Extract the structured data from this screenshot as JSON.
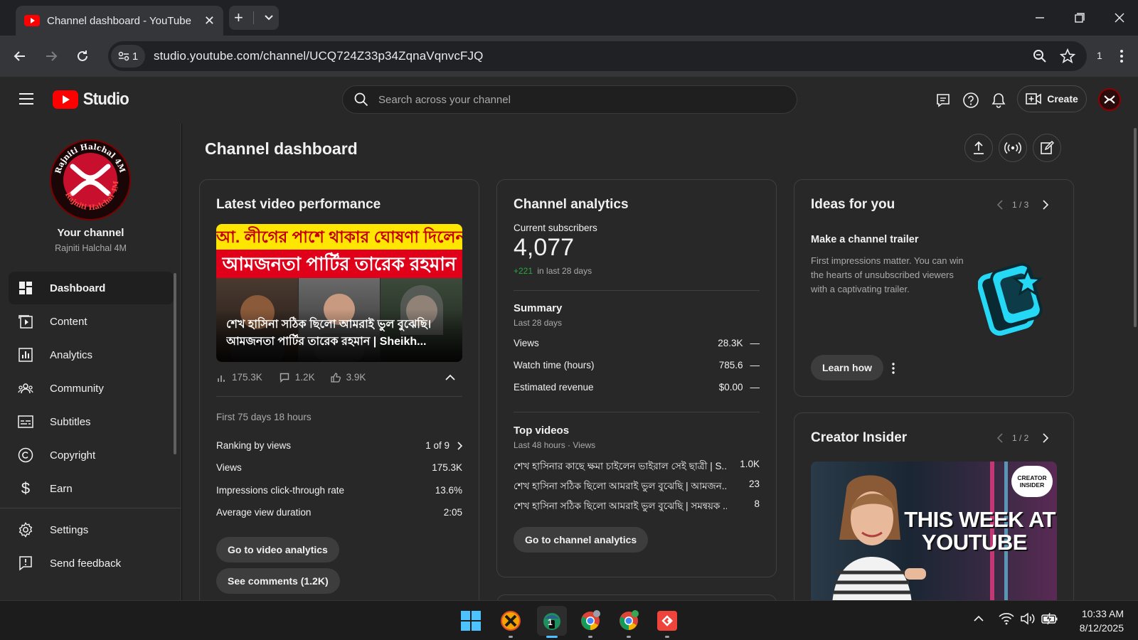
{
  "browser": {
    "tab_title": "Channel dashboard - YouTube Studio",
    "url": "studio.youtube.com/channel/UCQ724Z33p34ZqnaVqnvcFJQ",
    "site_info_count": "1",
    "extensions_count": "1"
  },
  "header": {
    "logo_text": "Studio",
    "search_placeholder": "Search across your channel",
    "create_label": "Create"
  },
  "sidebar": {
    "channel_label": "Your channel",
    "channel_name": "Rajniti Halchal 4M",
    "avatar_text_top": "Rajniti Halchal 4M",
    "avatar_text_bottom": "Rajniti Halchal 4M",
    "items": [
      {
        "label": "Dashboard",
        "icon": "dashboard-icon"
      },
      {
        "label": "Content",
        "icon": "content-icon"
      },
      {
        "label": "Analytics",
        "icon": "analytics-icon"
      },
      {
        "label": "Community",
        "icon": "community-icon"
      },
      {
        "label": "Subtitles",
        "icon": "subtitles-icon"
      },
      {
        "label": "Copyright",
        "icon": "copyright-icon"
      },
      {
        "label": "Earn",
        "icon": "earn-icon"
      }
    ],
    "bottom_items": [
      {
        "label": "Settings",
        "icon": "settings-icon"
      },
      {
        "label": "Send feedback",
        "icon": "feedback-icon"
      }
    ]
  },
  "main": {
    "page_title": "Channel dashboard",
    "latest_video": {
      "title": "Latest video performance",
      "thumb_line1": "আ. লীগের পাশে থাকার ঘোষণা দিলেন",
      "thumb_line2": "আমজনতা পার্টির তারেক রহমান",
      "video_title": "শেখ হাসিনা সঠিক ছিলো আমরাই ভুল বুঝেছি। আমজনতা পার্টির তারেক রহমান | Sheikh...",
      "views_stat": "175.3K",
      "comments_stat": "1.2K",
      "likes_stat": "3.9K",
      "period": "First 75 days 18 hours",
      "rows": [
        {
          "label": "Ranking by views",
          "value": "1 of 9"
        },
        {
          "label": "Views",
          "value": "175.3K"
        },
        {
          "label": "Impressions click-through rate",
          "value": "13.6%"
        },
        {
          "label": "Average view duration",
          "value": "2:05"
        }
      ],
      "btn_analytics": "Go to video analytics",
      "btn_comments": "See comments (1.2K)"
    },
    "channel_analytics": {
      "title": "Channel analytics",
      "subs_label": "Current subscribers",
      "subs_value": "4,077",
      "subs_change": "+221",
      "subs_change_period": "in last 28 days",
      "summary_title": "Summary",
      "summary_period": "Last 28 days",
      "summary_rows": [
        {
          "label": "Views",
          "value": "28.3K",
          "trend": "—"
        },
        {
          "label": "Watch time (hours)",
          "value": "785.6",
          "trend": "—"
        },
        {
          "label": "Estimated revenue",
          "value": "$0.00",
          "trend": "—"
        }
      ],
      "top_title": "Top videos",
      "top_period": "Last 48 hours · Views",
      "top_videos": [
        {
          "title": "শেখ হাসিনার কাছে ক্ষমা চাইলেন ভাইরাল সেই ছাত্রী | S...",
          "views": "1.0K"
        },
        {
          "title": "শেখ হাসিনা সঠিক ছিলো আমরাই ভুল বুঝেছি | আমজন...",
          "views": "23"
        },
        {
          "title": "শেখ হাসিনা সঠিক ছিলো আমরাই ভুল বুঝেছি | সমন্বয়ক ...",
          "views": "8"
        }
      ],
      "btn_channel": "Go to channel analytics"
    },
    "ideas": {
      "title": "Ideas for you",
      "pager": "1 / 3",
      "idea_title": "Make a channel trailer",
      "idea_text": "First impressions matter. You can win the hearts of unsubscribed viewers with a captivating trailer.",
      "btn_learn": "Learn how"
    },
    "creator_insider": {
      "title": "Creator Insider",
      "pager": "1 / 2",
      "thumb_headline_1": "THIS WEEK AT",
      "thumb_headline_2": "YOUTUBE",
      "badge_line1": "CREATOR",
      "badge_line2": "INSIDER"
    }
  },
  "taskbar": {
    "time": "10:33 AM",
    "date": "8/12/2025",
    "badge_count": "1"
  },
  "colors": {
    "youtube_red": "#ff0000",
    "positive_green": "#2ba640",
    "trailer_icon_cyan": "#25d8f5"
  }
}
